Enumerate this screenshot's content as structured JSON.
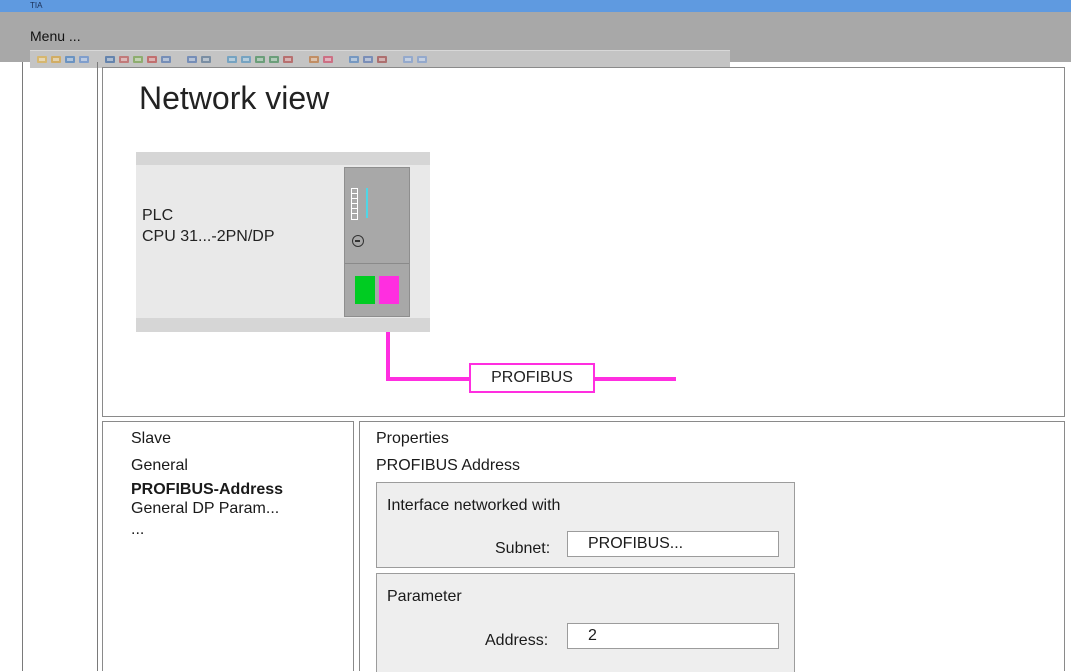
{
  "app": {
    "title": "TIA"
  },
  "menu": {
    "label": "Menu ..."
  },
  "toolbar": {
    "icons": [
      "new-icon",
      "open-icon",
      "save-icon",
      "print-icon",
      "cut-icon",
      "copy-icon",
      "paste-icon",
      "delete-icon",
      "undo-icon",
      "redo-icon",
      "compile-icon",
      "download-icon",
      "upload-icon",
      "online-icon",
      "offline-icon",
      "diagnostics-icon",
      "monitor-icon",
      "connect-icon",
      "compare-icon",
      "cross-reference-icon",
      "close-icon",
      "split-horizontal-icon",
      "split-vertical-icon"
    ]
  },
  "network_view": {
    "title": "Network view",
    "plc": {
      "name": "PLC",
      "cpu": "CPU 31...-2PN/DP"
    },
    "bus_label": "PROFIBUS",
    "colors": {
      "bus": "#ff2ee0",
      "port_pn": "#00cc22",
      "port_dp": "#ff2ee0"
    }
  },
  "slave": {
    "title": "Slave",
    "items": [
      {
        "label": "General",
        "bold": false
      },
      {
        "label": "PROFIBUS-Address",
        "bold": true
      },
      {
        "label": "General DP Param...",
        "bold": false
      },
      {
        "label": "...",
        "bold": false
      }
    ]
  },
  "properties": {
    "title": "Properties",
    "subtitle": "PROFIBUS Address",
    "interface_group": {
      "label": "Interface networked with",
      "subnet_label": "Subnet:",
      "subnet_value": "PROFIBUS..."
    },
    "parameter_group": {
      "label": "Parameter",
      "address_label": "Address:",
      "address_value": "2"
    }
  }
}
